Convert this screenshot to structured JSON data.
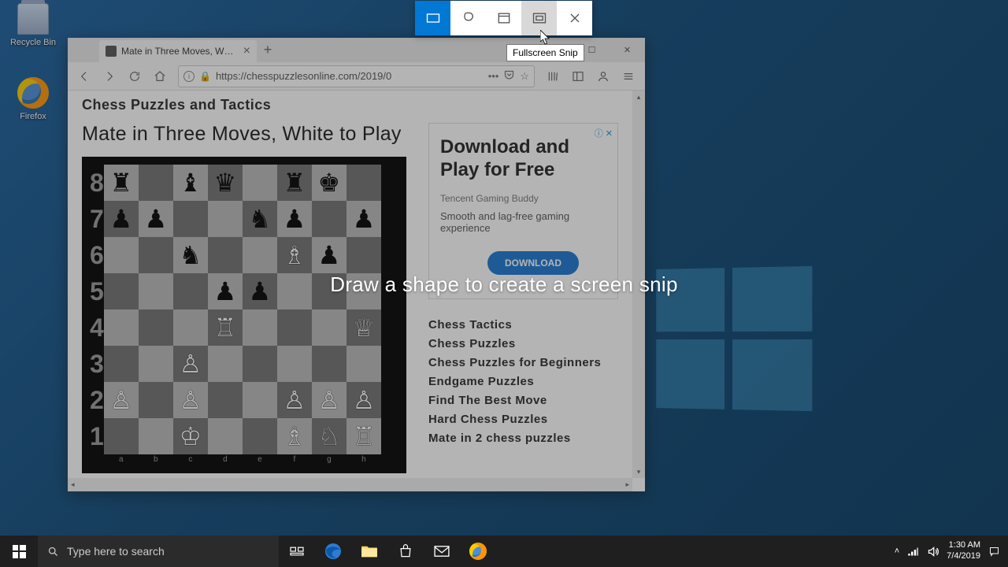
{
  "desktop": {
    "icons": [
      {
        "label": "Recycle Bin"
      },
      {
        "label": "Firefox"
      }
    ]
  },
  "snip": {
    "tooltip": "Fullscreen Snip",
    "instruction": "Draw a shape to create a screen snip",
    "modes": [
      "rectangular",
      "freeform",
      "window",
      "fullscreen",
      "close"
    ]
  },
  "browser": {
    "tab_title": "Mate in Three Moves, White to",
    "url": "https://chesspuzzlesonline.com/2019/0"
  },
  "page": {
    "site_title": "Chess Puzzles and Tactics",
    "puzzle_title": "Mate in Three Moves, White to Play",
    "ad": {
      "headline": "Download and Play for Free",
      "subtitle": "Tencent Gaming Buddy",
      "desc": "Smooth and lag-free gaming experience",
      "cta": "DOWNLOAD"
    },
    "tags": [
      "Chess Tactics",
      "Chess Puzzles",
      "Chess Puzzles for Beginners",
      "Endgame Puzzles",
      "Find The Best Move",
      "Hard Chess Puzzles",
      "Mate in 2 chess puzzles"
    ],
    "files": [
      "a",
      "b",
      "c",
      "d",
      "e",
      "f",
      "g",
      "h"
    ],
    "ranks": [
      "8",
      "7",
      "6",
      "5",
      "4",
      "3",
      "2",
      "1"
    ],
    "board": [
      [
        "♜",
        "",
        "♝",
        "♛",
        "",
        "♜",
        "♚",
        ""
      ],
      [
        "♟",
        "♟",
        "",
        "",
        "♞",
        "♟",
        "",
        "♟"
      ],
      [
        "",
        "",
        "♞",
        "",
        "",
        "♗",
        "♟",
        ""
      ],
      [
        "",
        "",
        "",
        "♟",
        "♟",
        "",
        "",
        ""
      ],
      [
        "",
        "",
        "",
        "♖",
        "",
        "",
        "",
        "♕"
      ],
      [
        "",
        "",
        "♙",
        "",
        "",
        "",
        "",
        ""
      ],
      [
        "♙",
        "",
        "♙",
        "",
        "",
        "♙",
        "♙",
        "♙"
      ],
      [
        "",
        "",
        "♔",
        "",
        "",
        "♗",
        "♘",
        "♖"
      ]
    ]
  },
  "taskbar": {
    "search_placeholder": "Type here to search",
    "time": "1:30 AM",
    "date": "7/4/2019"
  }
}
